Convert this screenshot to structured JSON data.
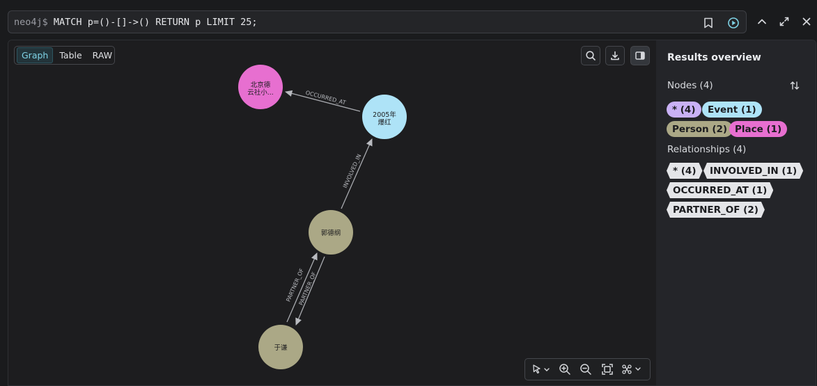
{
  "query": {
    "prompt": "neo4j$",
    "text": "MATCH p=()-[]->() RETURN p LIMIT 25;"
  },
  "view_tabs": [
    "Graph",
    "Table",
    "RAW"
  ],
  "graph": {
    "nodes": [
      {
        "id": "n1",
        "label_line1": "北京德",
        "label_line2": "云社小...",
        "category": "Place",
        "color": "#e76fd0"
      },
      {
        "id": "n2",
        "label_line1": "2005年",
        "label_line2": "爆红",
        "category": "Event",
        "color": "#aee3f7"
      },
      {
        "id": "n3",
        "label_line1": "郭德纲",
        "label_line2": "",
        "category": "Person",
        "color": "#aba886"
      },
      {
        "id": "n4",
        "label_line1": "于谦",
        "label_line2": "",
        "category": "Person",
        "color": "#aba886"
      }
    ],
    "relationships": [
      {
        "type": "OCCURRED_AT",
        "from": "n2",
        "to": "n1"
      },
      {
        "type": "INVOLVED_IN",
        "from": "n3",
        "to": "n2"
      },
      {
        "type": "PARTNER_OF",
        "from": "n4",
        "to": "n3"
      },
      {
        "type": "PARTNER_OF",
        "from": "n3",
        "to": "n4"
      }
    ]
  },
  "overview": {
    "title": "Results overview",
    "nodes_label": "Nodes (4)",
    "node_chips": [
      {
        "label": "* (4)",
        "color": "#c9b1f5"
      },
      {
        "label": "Event (1)",
        "color": "#aee3f7"
      },
      {
        "label": "Person (2)",
        "color": "#aba886"
      },
      {
        "label": "Place (1)",
        "color": "#e76fd0"
      }
    ],
    "relationships_label": "Relationships (4)",
    "rel_chips": [
      "* (4)",
      "INVOLVED_IN (1)",
      "OCCURRED_AT (1)",
      "PARTNER_OF (2)"
    ]
  }
}
